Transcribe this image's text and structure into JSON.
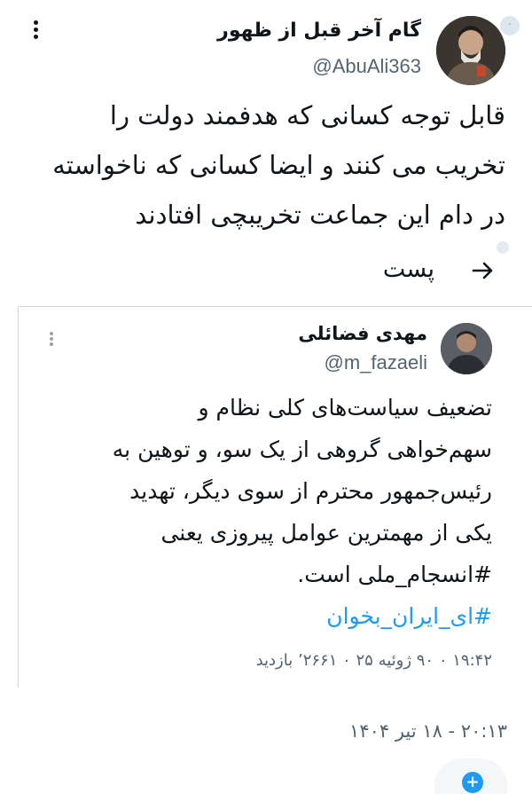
{
  "tweet": {
    "author_name": "گام آخر قبل از ظهور",
    "author_handle": "@AbuAli363",
    "text_lines": [
      "قابل توجه کسانی که هدفمند دولت را",
      "تخریب می کنند  و ایضا کسانی که ناخواسته",
      "در دام این جماعت تخریبچی افتادند"
    ],
    "timestamp": "۲۰:۱۳ - ۱۸ تیر ۱۴۰۴"
  },
  "nav": {
    "tab_label": "پست"
  },
  "quote": {
    "author_name": "مهدی فضائلی",
    "author_handle": "@m_fazaeli",
    "text_lines": [
      "تضعیف سیاست‌های کلی نظام و",
      "سهم‌خواهی گروهی از یک سو، و توهین به",
      "رئیس‌جمهور محترم از سوی دیگر، تهدید",
      "یکی از مهمترین عوامل پیروزی یعنی",
      "#انسجام_ملی است."
    ],
    "hashtag2": "#ای_ایران_بخوان",
    "meta": "۱۹:۴۲ ۰ ۹۰ ژوئیه ۲۵ ۰ ۲۶۶۱’ بازدید"
  },
  "icons": {
    "more": "more-vertical-icon",
    "back": "arrow-right-icon",
    "add": "plus-icon"
  },
  "colors": {
    "link": "#1d9bf0",
    "secondary_text": "#536471",
    "primary_text": "#0f1419"
  }
}
